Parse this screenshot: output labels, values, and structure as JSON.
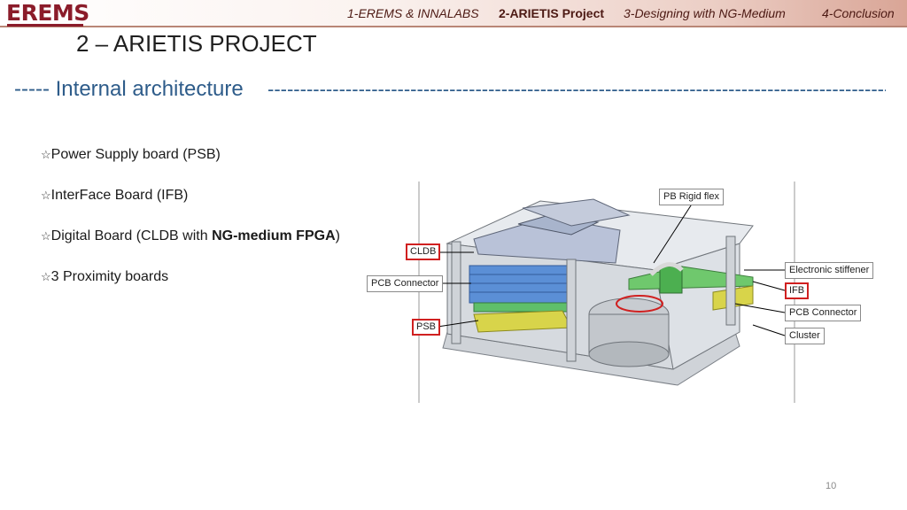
{
  "header": {
    "logo_text": "EREMS",
    "nav": [
      {
        "label": "1-EREMS & INNALABS",
        "active": false
      },
      {
        "label": "2-ARIETIS Project",
        "active": true
      },
      {
        "label": "3-Designing with NG-Medium",
        "active": false
      },
      {
        "label": "4-Conclusion",
        "active": false
      }
    ]
  },
  "slide": {
    "title": "2 – ARIETIS PROJECT",
    "subtitle": "----- Internal architecture",
    "dashes": "--------------------------------------------------------------------------------------------------------",
    "bullets": [
      {
        "text": "Power Supply board (PSB)"
      },
      {
        "text": "InterFace Board (IFB)"
      },
      {
        "text_before": "Digital Board (CLDB with ",
        "bold": "NG-medium FPGA",
        "text_after": ")"
      },
      {
        "text": "3 Proximity boards"
      }
    ],
    "page_number": "10"
  },
  "figure": {
    "callouts": {
      "pb_rigid_flex": "PB Rigid flex",
      "cldb": "CLDB",
      "pcb_connector_left": "PCB Connector",
      "psb": "PSB",
      "electronic_stiffener": "Electronic stiffener",
      "ifb": "IFB",
      "pcb_connector_right": "PCB Connector",
      "cluster": "Cluster"
    }
  },
  "colors": {
    "brand": "#8b1c2a",
    "subtitle_blue": "#2e5c8a",
    "highlight_red": "#d02020"
  }
}
